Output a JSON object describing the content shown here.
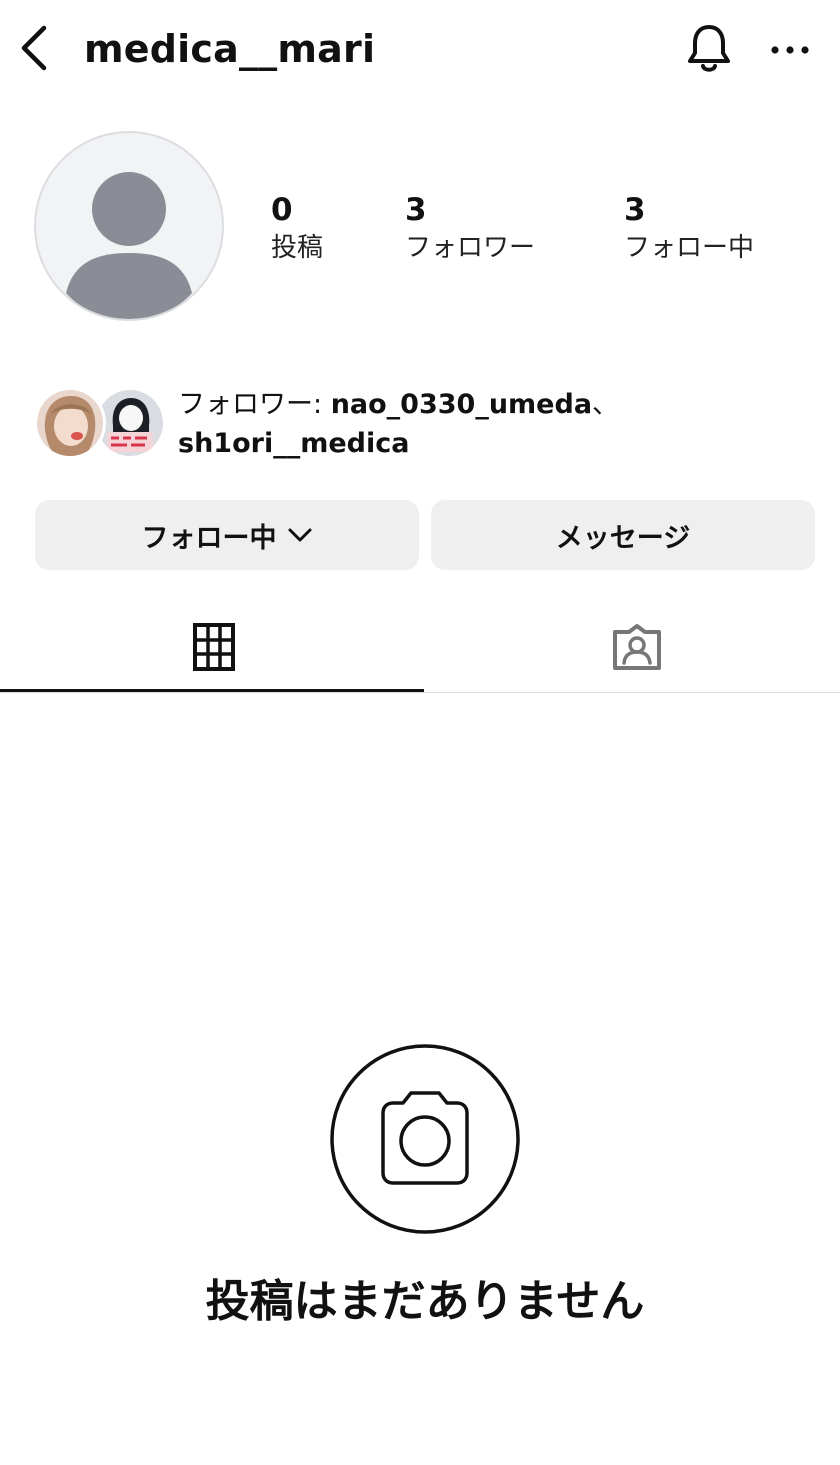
{
  "header": {
    "username": "medica__mari",
    "back_icon": "chevron-left-icon",
    "bell_icon": "bell-icon",
    "more_icon": "more-horizontal-icon"
  },
  "profile": {
    "avatar": "default-avatar-icon",
    "stats": [
      {
        "value": "0",
        "label": "投稿"
      },
      {
        "value": "3",
        "label": "フォロワー"
      },
      {
        "value": "3",
        "label": "フォロー中"
      }
    ]
  },
  "mutuals": {
    "prefix": "フォロワー: ",
    "first": "nao_0330_umeda",
    "separator": "、",
    "second": "sh1ori__medica"
  },
  "actions": {
    "following_label": "フォロー中",
    "message_label": "メッセージ"
  },
  "tabs": [
    {
      "icon": "grid-icon",
      "active": true
    },
    {
      "icon": "tagged-icon",
      "active": false
    }
  ],
  "empty_state": {
    "icon": "camera-icon",
    "text": "投稿はまだありません"
  },
  "colors": {
    "button_bg": "#efefef",
    "avatar_bg": "#f2f3f5",
    "avatar_fg": "#8a8d96",
    "text": "#111111"
  }
}
